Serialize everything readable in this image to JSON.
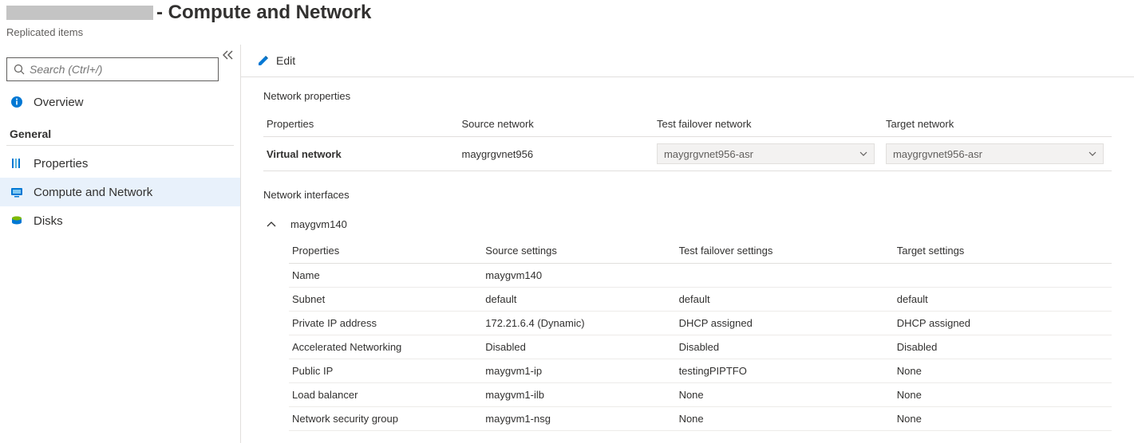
{
  "header": {
    "title_suffix": "- Compute and Network",
    "breadcrumb": "Replicated items"
  },
  "sidebar": {
    "search_placeholder": "Search (Ctrl+/)",
    "overview_label": "Overview",
    "section_general": "General",
    "properties_label": "Properties",
    "compute_network_label": "Compute and Network",
    "disks_label": "Disks"
  },
  "toolbar": {
    "edit_label": "Edit"
  },
  "network_properties": {
    "section_title": "Network properties",
    "headers": {
      "properties": "Properties",
      "source": "Source network",
      "test": "Test failover network",
      "target": "Target network"
    },
    "row": {
      "label": "Virtual network",
      "source": "maygrgvnet956",
      "test": "maygrgvnet956-asr",
      "target": "maygrgvnet956-asr"
    }
  },
  "nic": {
    "section_title": "Network interfaces",
    "name": "maygvm140",
    "headers": {
      "properties": "Properties",
      "source": "Source settings",
      "test": "Test failover settings",
      "target": "Target settings"
    },
    "rows": [
      {
        "label": "Name",
        "source": "maygvm140",
        "test": "",
        "target": ""
      },
      {
        "label": "Subnet",
        "source": "default",
        "test": "default",
        "target": "default"
      },
      {
        "label": "Private IP address",
        "source": "172.21.6.4 (Dynamic)",
        "test": "DHCP assigned",
        "target": "DHCP assigned"
      },
      {
        "label": "Accelerated Networking",
        "source": "Disabled",
        "test": "Disabled",
        "target": "Disabled"
      },
      {
        "label": "Public IP",
        "source": "maygvm1-ip",
        "test": "testingPIPTFO",
        "target": "None"
      },
      {
        "label": "Load balancer",
        "source": "maygvm1-ilb",
        "test": "None",
        "target": "None"
      },
      {
        "label": "Network security group",
        "source": "maygvm1-nsg",
        "test": "None",
        "target": "None"
      }
    ]
  }
}
